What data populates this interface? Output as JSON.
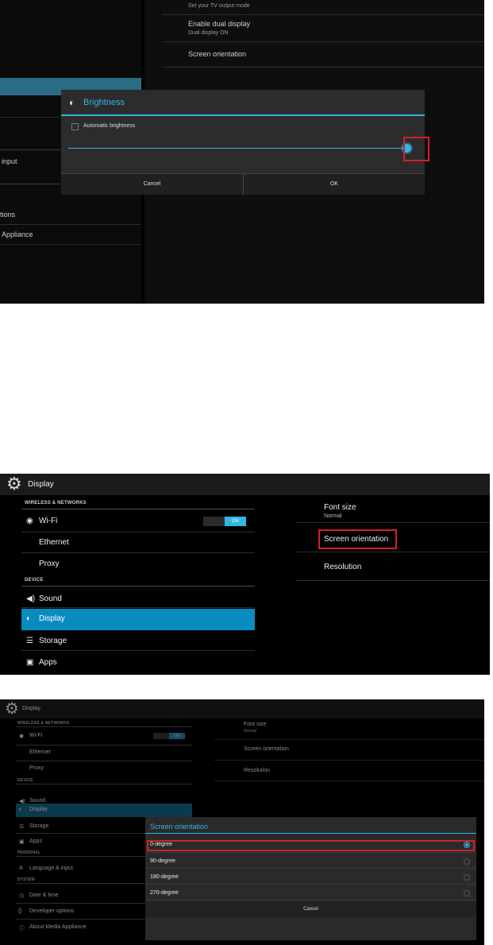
{
  "s1": {
    "tv_output_sub": "Set your TV output mode",
    "dual_display_title": "Enable dual display",
    "dual_display_sub": "Dual display ON",
    "screen_orientation": "Screen orientation",
    "left_items": [
      "input",
      "tions",
      "Appliance"
    ],
    "dialog": {
      "title": "Brightness",
      "auto_label": "Automatic brightness",
      "brightness_level": 0.99,
      "cancel": "Cancel",
      "ok": "OK"
    },
    "colors": {
      "accent": "#33b5e5",
      "highlight": "#d51f26"
    }
  },
  "s2": {
    "title": "Display",
    "section_wireless": "WIRELESS & NETWORKS",
    "wifi": "Wi-Fi",
    "wifi_switch": "ON",
    "ethernet": "Ethernet",
    "proxy": "Proxy",
    "section_device": "DEVICE",
    "sound": "Sound",
    "display": "Display",
    "storage": "Storage",
    "apps": "Apps",
    "font_size": "Font size",
    "font_size_value": "Normal",
    "screen_orientation": "Screen orientation",
    "resolution": "Resolution",
    "icons": [
      "gear-icon",
      "wifi-icon",
      "sound-icon",
      "display-icon",
      "storage-icon",
      "apps-icon"
    ]
  },
  "s3": {
    "title": "Display",
    "section_wireless": "WIRELESS & NETWORKS",
    "wifi": "Wi-Fi",
    "wifi_switch": "ON",
    "ethernet": "Ethernet",
    "proxy": "Proxy",
    "section_device": "DEVICE",
    "sound": "Sound",
    "display": "Display",
    "storage": "Storage",
    "apps": "Apps",
    "section_personal": "PERSONAL",
    "language": "Language & input",
    "section_system": "SYSTEM",
    "datetime": "Date & time",
    "developer": "Developer options",
    "about": "About Media Appliance",
    "font_size": "Font size",
    "font_size_value": "Normal",
    "screen_orientation": "Screen orientation",
    "resolution": "Resolution",
    "dialog": {
      "title": "Screen orientation",
      "options": [
        "0-degree",
        "90-degree",
        "180-degree",
        "270-degree"
      ],
      "selected": "0-degree",
      "cancel": "Cancel"
    }
  }
}
